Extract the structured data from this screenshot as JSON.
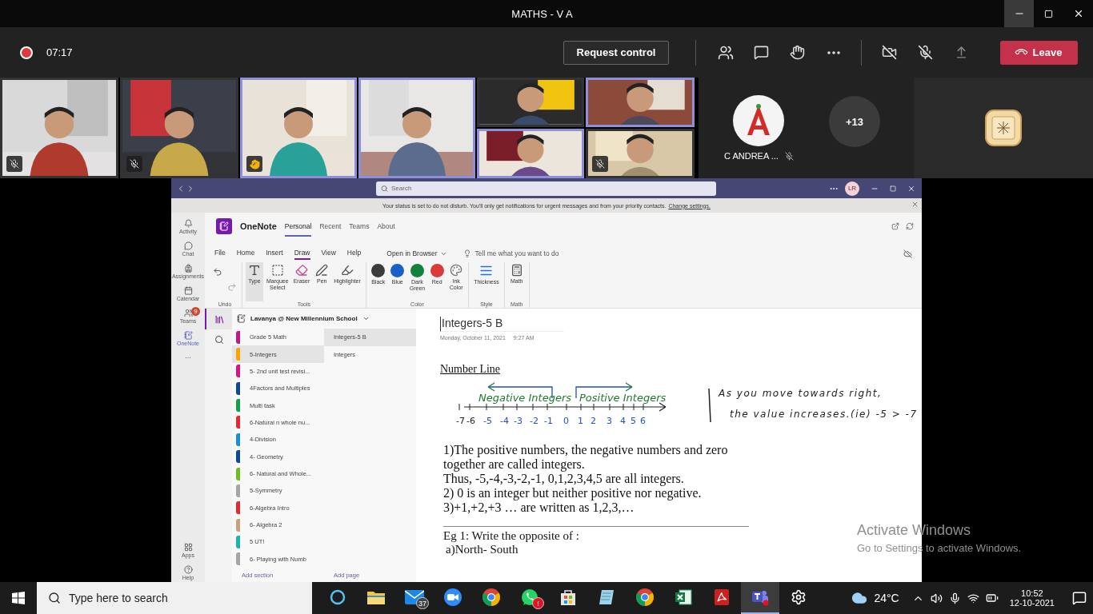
{
  "window": {
    "title": "MATHS - V A"
  },
  "meeting_bar": {
    "recording": true,
    "timer": "07:17",
    "request_control": "Request control",
    "leave": "Leave"
  },
  "video_tiles": [
    {
      "kind": "tall",
      "muted": true,
      "hand_raised": false,
      "highlighted": false
    },
    {
      "kind": "tall",
      "muted": true,
      "hand_raised": false,
      "highlighted": false
    },
    {
      "kind": "tall",
      "muted": false,
      "hand_raised": true,
      "highlighted": true
    },
    {
      "kind": "tall",
      "muted": false,
      "hand_raised": false,
      "highlighted": true
    },
    {
      "kind": "half",
      "muted": false,
      "hand_raised": false,
      "highlighted": false
    },
    {
      "kind": "half",
      "muted": false,
      "hand_raised": false,
      "highlighted": true
    },
    {
      "kind": "half",
      "muted": false,
      "hand_raised": false,
      "highlighted": true
    },
    {
      "kind": "half",
      "muted": true,
      "hand_raised": false,
      "highlighted": false
    }
  ],
  "avatar_participant": {
    "name": "C ANDREA ...",
    "muted": true
  },
  "overflow_count": "+13",
  "shared_screen": {
    "search": {
      "placeholder": "Search"
    },
    "user_initials": "LR",
    "notice": {
      "text": "Your status is set to do not disturb. You'll only get notifications for urgent messages and from your priority contacts.",
      "link": "Change settings."
    },
    "rail": [
      {
        "kind": "activity",
        "label": "Activity",
        "selected": false
      },
      {
        "kind": "chat",
        "label": "Chat",
        "selected": false
      },
      {
        "kind": "assignments",
        "label": "Assignments",
        "selected": false
      },
      {
        "kind": "calendar",
        "label": "Calendar",
        "selected": false
      },
      {
        "kind": "teams",
        "label": "Teams",
        "selected": false,
        "badge": "9"
      },
      {
        "kind": "onenote",
        "label": "OneNote",
        "selected": true
      }
    ],
    "rail_more": "...",
    "rail_bottom": [
      {
        "kind": "apps",
        "label": "Apps"
      },
      {
        "kind": "help",
        "label": "Help"
      }
    ],
    "app": {
      "name": "OneNote",
      "tabs": [
        {
          "label": "Personal",
          "selected": true
        },
        {
          "label": "Recent",
          "selected": false
        },
        {
          "label": "Teams",
          "selected": false
        },
        {
          "label": "About",
          "selected": false
        }
      ]
    },
    "ribbon": {
      "tabs": [
        {
          "label": "File",
          "selected": false
        },
        {
          "label": "Home",
          "selected": false
        },
        {
          "label": "Insert",
          "selected": false
        },
        {
          "label": "Draw",
          "selected": true
        },
        {
          "label": "View",
          "selected": false
        },
        {
          "label": "Help",
          "selected": false
        }
      ],
      "open_in_browser": "Open in Browser",
      "tell_me": "Tell me what you want to do",
      "groups": [
        {
          "label": "Undo",
          "tools": [
            {
              "kind": "undo",
              "selected": false
            },
            {
              "kind": "redo",
              "selected": false
            }
          ]
        },
        {
          "label": "Tools",
          "tools": [
            {
              "kind": "type",
              "label": "Type",
              "selected": true
            },
            {
              "kind": "marquee",
              "label": "Marquee Select",
              "selected": false
            },
            {
              "kind": "eraser",
              "label": "Eraser",
              "selected": false
            },
            {
              "kind": "pen",
              "label": "Pen",
              "selected": false
            },
            {
              "kind": "highlighter",
              "label": "Highlighter",
              "selected": false
            }
          ]
        },
        {
          "label": "Color",
          "tools": [
            {
              "kind": "color",
              "label": "Black",
              "color": "#3b3b3b",
              "selected": false
            },
            {
              "kind": "color",
              "label": "Blue",
              "color": "#1b5fc9",
              "selected": false
            },
            {
              "kind": "color",
              "label": "Dark Green",
              "color": "#12823b",
              "selected": false
            },
            {
              "kind": "color",
              "label": "Red",
              "color": "#d83b3b",
              "selected": false
            },
            {
              "kind": "ink_color",
              "label": "Ink Color",
              "selected": false
            }
          ]
        },
        {
          "label": "Style",
          "tools": [
            {
              "kind": "thickness",
              "label": "Thickness",
              "selected": false
            }
          ]
        },
        {
          "label": "Math",
          "tools": [
            {
              "kind": "math",
              "label": "Math",
              "selected": false
            }
          ]
        }
      ]
    },
    "notebook": {
      "name": "Lavanya @ New Millennium School",
      "sections": [
        {
          "name": "Grade 5 Math",
          "color": "#c4168b",
          "selected": false
        },
        {
          "name": "5-Integers",
          "color": "#f7a600",
          "selected": true
        },
        {
          "name": "5- 2nd unit test revisi...",
          "color": "#d8147f",
          "selected": false
        },
        {
          "name": "4Factors and Multiples",
          "color": "#0c4a94",
          "selected": false
        },
        {
          "name": "Multi task",
          "color": "#10a14c",
          "selected": false
        },
        {
          "name": "6-Natural n whole nu...",
          "color": "#e7272d",
          "selected": false
        },
        {
          "name": "4-Division",
          "color": "#1b8fd8",
          "selected": false
        },
        {
          "name": "4- Geometry",
          "color": "#0c4a94",
          "selected": false
        },
        {
          "name": "6- Natural and Whole...",
          "color": "#6fbe1f",
          "selected": false
        },
        {
          "name": "5-Symmetry",
          "color": "#a6a6a6",
          "selected": false
        },
        {
          "name": "6-Algebra Intro",
          "color": "#e7272d",
          "selected": false
        },
        {
          "name": "6- Algebra 2",
          "color": "#c7a27a",
          "selected": false
        },
        {
          "name": "5 UT!",
          "color": "#16b5b0",
          "selected": false
        },
        {
          "name": "6- Playing with Numb",
          "color": "#a6a6a6",
          "selected": false
        }
      ],
      "pages": [
        {
          "title": "Integers-5 B",
          "selected": true
        },
        {
          "title": "Integers",
          "selected": false
        }
      ],
      "add_section": "Add section",
      "add_page": "Add page"
    },
    "page": {
      "title": "Integers-5 B",
      "date": "Monday, October 11, 2021",
      "time": "9:27 AM",
      "heading": "Number Line",
      "ink": {
        "negative_label": "Negative Integers",
        "positive_label": "Positive Integers",
        "ticks": [
          {
            "label": "-7",
            "color": "#222222"
          },
          {
            "label": "-6",
            "color": "#222222"
          },
          {
            "label": "-5",
            "color": "#1f4fc1"
          },
          {
            "label": "-4",
            "color": "#1f4fc1"
          },
          {
            "label": "-3",
            "color": "#1f4fc1"
          },
          {
            "label": "-2",
            "color": "#1f4fc1"
          },
          {
            "label": "-1",
            "color": "#1f4fc1"
          },
          {
            "label": "0",
            "color": "#1f4fc1"
          },
          {
            "label": "1",
            "color": "#1f4fc1"
          },
          {
            "label": "2",
            "color": "#1f4fc1"
          },
          {
            "label": "3",
            "color": "#1f4fc1"
          },
          {
            "label": "4",
            "color": "#1f4fc1"
          },
          {
            "label": "5",
            "color": "#1f4fc1"
          },
          {
            "label": "6",
            "color": "#1f4fc1"
          }
        ],
        "note_lines": [
          "As you move towards right,",
          "the value increases.(ie) -5 > -7"
        ]
      },
      "paragraphs": [
        "1)The positive numbers, the negative numbers and zero together are called integers.",
        "Thus, -5,-4,-3,-2,-1, 0,1,2,3,4,5 are all integers.",
        "2) 0 is an integer but neither positive nor negative.",
        "3)+1,+2,+3 … are written as 1,2,3,…"
      ],
      "example": {
        "title": "Eg 1: Write the opposite of :",
        "items": [
          "a)North- South"
        ]
      }
    }
  },
  "activation_notice": {
    "title": "Activate Windows",
    "text": "Go to Settings to activate Windows."
  },
  "taskbar": {
    "search": {
      "placeholder": "Type here to search"
    },
    "apps": [
      {
        "kind": "cortana",
        "selected": false
      },
      {
        "kind": "explorer",
        "selected": false
      },
      {
        "kind": "mail",
        "selected": false,
        "badge": "37"
      },
      {
        "kind": "zoom",
        "selected": false
      },
      {
        "kind": "chrome",
        "selected": false
      },
      {
        "kind": "whatsapp",
        "selected": false,
        "badge": "!"
      },
      {
        "kind": "store",
        "selected": false
      },
      {
        "kind": "notes",
        "selected": false
      },
      {
        "kind": "chrome",
        "selected": false
      },
      {
        "kind": "excel",
        "selected": false
      },
      {
        "kind": "acrobat",
        "selected": false
      },
      {
        "kind": "teams",
        "selected": true
      },
      {
        "kind": "settings",
        "selected": false
      }
    ],
    "weather": "24°C",
    "time": "10:52",
    "date": "12-10-2021"
  }
}
